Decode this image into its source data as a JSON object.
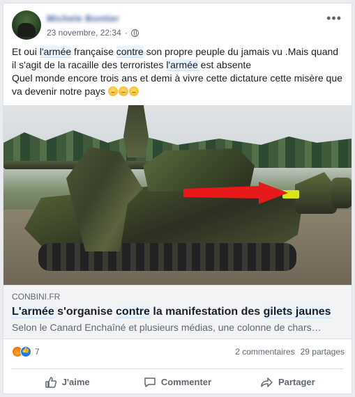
{
  "author": {
    "name": "Michele Bontier"
  },
  "post": {
    "timestamp": "23 novembre, 22:34",
    "text": {
      "p1": "Et oui ",
      "hl1": "l'armée",
      "p2": " française ",
      "hl2": "contre",
      "p3": " son propre peuple du jamais vu .Mais quand il s'agit de la racaille des terroristes ",
      "hl3": "l'armée",
      "p4": " est absente",
      "line2": "Quel monde encore trois ans et demi à vivre cette dictature cette misère que va devenir notre pays"
    }
  },
  "link": {
    "domain": "CONBINI.FR",
    "title_hl1": "L'armée",
    "title_p1": " s'organise ",
    "title_hl2": "contre",
    "title_p2": " la manifestation des ",
    "title_hl3": "gilets jaunes",
    "description": "Selon le Canard Enchaîné et plusieurs médias, une colonne de chars…"
  },
  "stats": {
    "reaction_count": "7",
    "comments": "2 commentaires",
    "shares": "29 partages"
  },
  "actions": {
    "like": "J'aime",
    "comment": "Commenter",
    "share": "Partager"
  },
  "icons": {
    "like": "thumbs-up-icon",
    "comment": "speech-bubble-icon",
    "share": "share-arrow-icon",
    "privacy": "globe-icon",
    "more": "more-dots-icon"
  },
  "colors": {
    "link_blue": "#385898",
    "highlight_bg": "#e7f3ff",
    "arrow_red": "#e8191b"
  }
}
